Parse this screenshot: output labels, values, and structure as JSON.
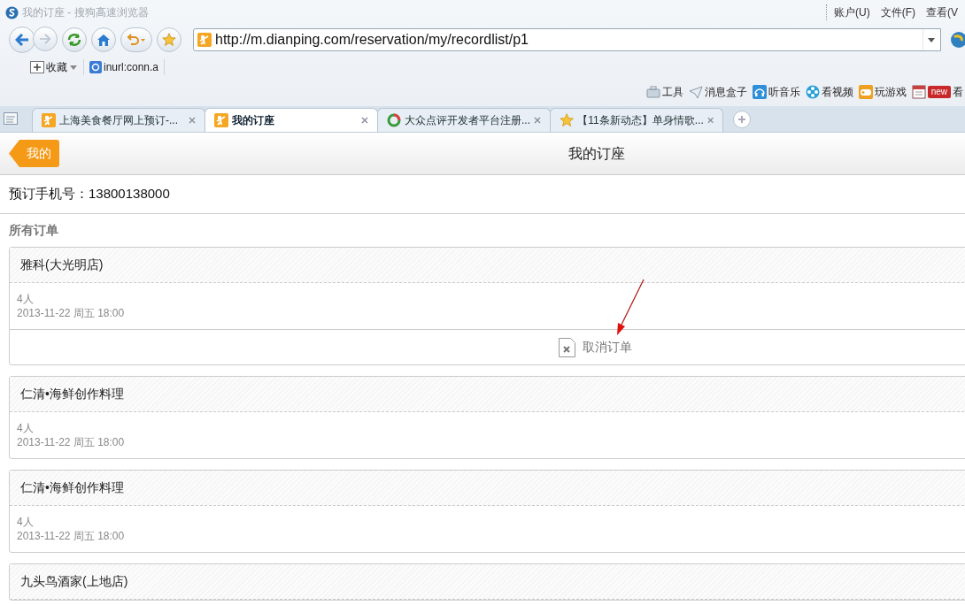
{
  "window": {
    "title": "我的订座 - 搜狗高速浏览器"
  },
  "menu": [
    "账户(U)",
    "文件(F)",
    "查看(V"
  ],
  "address": {
    "url": "http://m.dianping.com/reservation/my/recordlist/p1"
  },
  "bookmarks": [
    {
      "label": "收藏",
      "kind": "folder"
    },
    {
      "label": "inurl:conn.a",
      "kind": "search"
    }
  ],
  "tools": [
    {
      "label": "工具",
      "kind": "toolbox"
    },
    {
      "label": "消息盒子",
      "kind": "plane"
    },
    {
      "label": "听音乐",
      "kind": "headphones"
    },
    {
      "label": "看视频",
      "kind": "film"
    },
    {
      "label": "玩游戏",
      "kind": "gamepad"
    },
    {
      "label": "看",
      "kind": "news",
      "badge": "new"
    }
  ],
  "tabs": [
    {
      "label": "上海美食餐厅网上预订-...",
      "selected": false,
      "kind": "figure"
    },
    {
      "label": "我的订座",
      "selected": true,
      "kind": "figure"
    },
    {
      "label": "大众点评开发者平台注册...",
      "selected": false,
      "kind": "ring"
    },
    {
      "label": "【11条新动态】单身情歌...",
      "selected": false,
      "kind": "star"
    }
  ],
  "page": {
    "back_button": "我的",
    "title": "我的订座",
    "phone_label": "预订手机号：",
    "phone": "13800138000",
    "section": "所有订单",
    "orders": [
      {
        "name": "雅科(大光明店)",
        "people": "4人",
        "time": "2013-11-22 周五 18:00",
        "action": "取消订单"
      },
      {
        "name": "仁清•海鲜创作料理",
        "people": "4人",
        "time": "2013-11-22 周五 18:00"
      },
      {
        "name": "仁清•海鲜创作料理",
        "people": "4人",
        "time": "2013-11-22 周五 18:00"
      },
      {
        "name": "九头鸟酒家(上地店)"
      }
    ]
  }
}
